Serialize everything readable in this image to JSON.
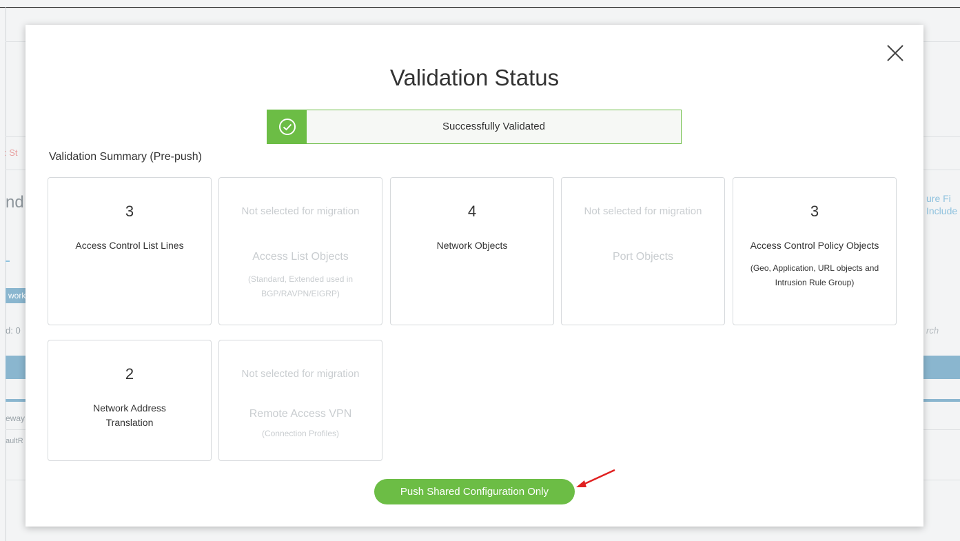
{
  "background": {
    "fragments": [
      {
        "id": "frag-st",
        "text": ": St"
      },
      {
        "id": "frag-nd",
        "text": "nd"
      },
      {
        "id": "frag-work",
        "text": "work"
      },
      {
        "id": "frag-d0",
        "text": "d: 0"
      },
      {
        "id": "frag-eway",
        "text": "eway"
      },
      {
        "id": "frag-aultr",
        "text": "aultR"
      },
      {
        "id": "frag-urefi",
        "text": "ure Fi"
      },
      {
        "id": "frag-include",
        "text": "Include"
      },
      {
        "id": "frag-search",
        "text": "rch"
      }
    ]
  },
  "modal": {
    "title": "Validation Status",
    "status": {
      "text": "Successfully Validated",
      "color": "#6cbd45"
    },
    "summary_label": "Validation Summary (Pre-push)",
    "cards": [
      {
        "count": "3",
        "name": "Access Control List Lines",
        "sub": "",
        "selected": true
      },
      {
        "status": "Not selected for migration",
        "name": "Access List Objects",
        "sub": "(Standard, Extended used in BGP/RAVPN/EIGRP)",
        "selected": false
      },
      {
        "count": "4",
        "name": "Network Objects",
        "sub": "",
        "selected": true
      },
      {
        "status": "Not selected for migration",
        "name": "Port Objects",
        "sub": "",
        "selected": false
      },
      {
        "count": "3",
        "name": "Access Control Policy Objects",
        "sub": "(Geo, Application, URL objects and Intrusion Rule Group)",
        "selected": true
      },
      {
        "count": "2",
        "name": "Network Address Translation",
        "sub": "",
        "selected": true
      },
      {
        "status": "Not selected for migration",
        "name": "Remote Access VPN",
        "sub": "(Connection Profiles)",
        "selected": false
      }
    ],
    "push_button_label": "Push Shared Configuration Only",
    "close_icon": "close-icon",
    "status_icon": "check-circle-icon",
    "accent_color": "#6cbd45",
    "annotation_arrow_color": "#e02020"
  }
}
